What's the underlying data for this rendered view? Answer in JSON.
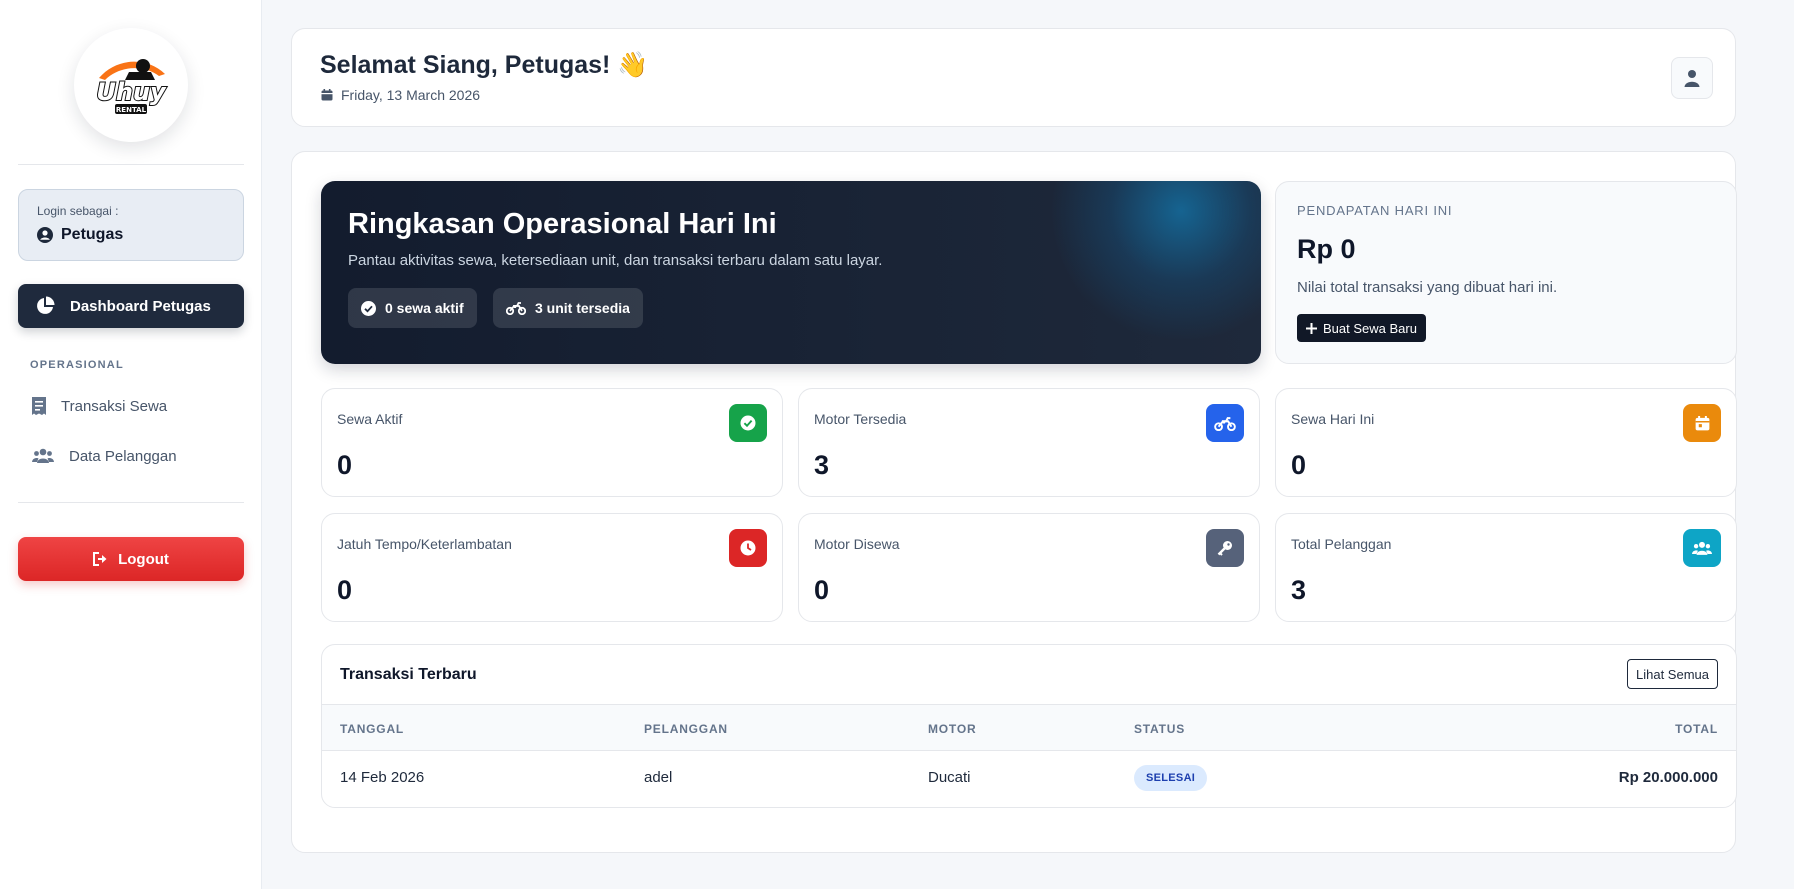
{
  "sidebar": {
    "logo_text": "Uhuy",
    "logo_subtext": "RENTAL",
    "login_caption": "Login sebagai :",
    "login_role": "Petugas",
    "nav_active_label": "Dashboard Petugas",
    "section_label": "OPERASIONAL",
    "items": [
      {
        "label": "Transaksi Sewa",
        "icon": "receipt-icon"
      },
      {
        "label": "Data Pelanggan",
        "icon": "users-icon"
      }
    ],
    "logout_label": "Logout"
  },
  "header": {
    "greeting": "Selamat Siang, Petugas! 👋",
    "date": "Friday, 13 March 2026"
  },
  "hero": {
    "title": "Ringkasan Operasional Hari Ini",
    "subtitle": "Pantau aktivitas sewa, ketersediaan unit, dan transaksi terbaru dalam satu layar.",
    "pill_active": "0 sewa aktif",
    "pill_available": "3 unit tersedia"
  },
  "income": {
    "label": "PENDAPATAN HARI INI",
    "value": "Rp 0",
    "desc": "Nilai total transaksi yang dibuat hari ini.",
    "button": "Buat Sewa Baru"
  },
  "stats": [
    {
      "label": "Sewa Aktif",
      "value": "0",
      "icon": "check-circle-icon",
      "color": "#16a34a"
    },
    {
      "label": "Motor Tersedia",
      "value": "3",
      "icon": "motorcycle-icon",
      "color": "#2563eb"
    },
    {
      "label": "Sewa Hari Ini",
      "value": "0",
      "icon": "calendar-icon",
      "color": "#ea8a0c"
    },
    {
      "label": "Jatuh Tempo/Keterlambatan",
      "value": "0",
      "icon": "clock-icon",
      "color": "#dc2626"
    },
    {
      "label": "Motor Disewa",
      "value": "0",
      "icon": "key-icon",
      "color": "#56627a"
    },
    {
      "label": "Total Pelanggan",
      "value": "3",
      "icon": "users-icon",
      "color": "#0ea5c6"
    }
  ],
  "table": {
    "title": "Transaksi Terbaru",
    "see_all": "Lihat Semua",
    "columns": [
      "TANGGAL",
      "PELANGGAN",
      "MOTOR",
      "STATUS",
      "TOTAL"
    ],
    "rows": [
      {
        "tanggal": "14 Feb 2026",
        "pelanggan": "adel",
        "motor": "Ducati",
        "status": "SELESAI",
        "total": "Rp 20.000.000"
      }
    ]
  }
}
